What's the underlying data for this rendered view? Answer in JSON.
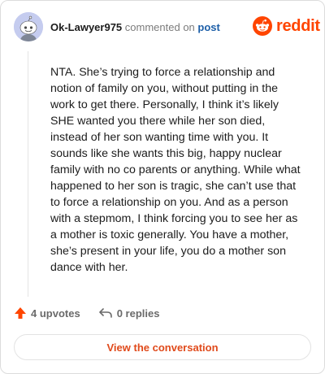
{
  "header": {
    "username": "Ok-Lawyer975",
    "commented_on": "commented on",
    "post_link": "post"
  },
  "brand": {
    "name": "reddit",
    "icon": "reddit-alien-icon",
    "color": "#ff4500"
  },
  "comment": {
    "text": "NTA. She’s trying to force a relationship and notion of family on you, without putting in the work to get there. Personally, I think it’s likely SHE wanted you there while her son died, instead of her son wanting time with you. It sounds like she wants this big, happy nuclear family with no co parents or anything. While what happened to her son is tragic, she can’t use that to force a relationship on you. And as a person with a stepmom, I think forcing you to see her as a mother is toxic generally. You have a mother, she’s present in your life, you do a mother son dance with her."
  },
  "actions": {
    "upvotes_label": "4 upvotes",
    "upvote_icon": "upvote-arrow-icon",
    "replies_label": "0 replies",
    "reply_icon": "reply-arrow-icon"
  },
  "cta": {
    "label": "View the conversation",
    "color": "#e04a1b"
  }
}
